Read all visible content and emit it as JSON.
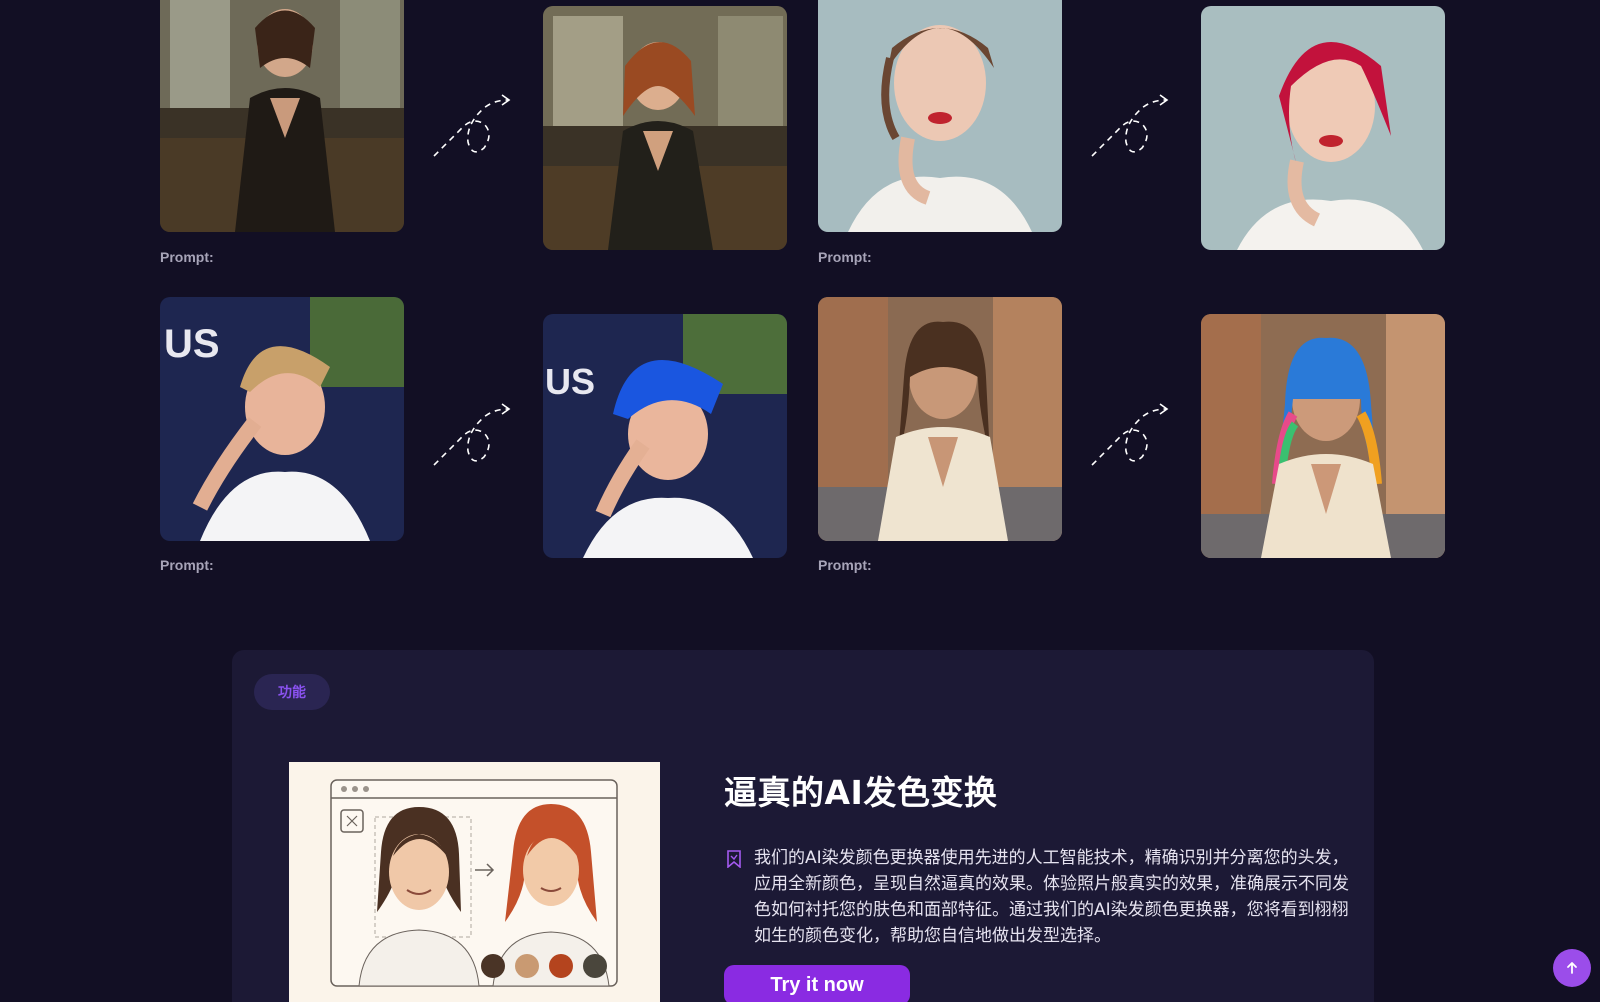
{
  "examples": [
    {
      "prompt_label": "Prompt:",
      "before_desc": "woman-dark-hair-black-dress",
      "after_desc": "woman-auburn-hair-black-dress"
    },
    {
      "prompt_label": "Prompt:",
      "before_desc": "woman-brown-hair-white-blouse",
      "after_desc": "woman-red-hair-white-blouse"
    },
    {
      "prompt_label": "Prompt:",
      "before_desc": "man-blonde-hair-white-tshirt",
      "after_desc": "man-blue-hair-white-tshirt"
    },
    {
      "prompt_label": "Prompt:",
      "before_desc": "woman-brown-hair-cream-blouse",
      "after_desc": "woman-rainbow-hair-cream-blouse"
    }
  ],
  "feature": {
    "badge": "功能",
    "title": "逼真的AI发色变换",
    "description": "我们的AI染发颜色更换器使用先进的人工智能技术，精确识别并分离您的头发，应用全新颜色，呈现自然逼真的效果。体验照片般真实的效果，准确展示不同发色如何衬托您的肤色和面部特征。通过我们的AI染发颜色更换器，您将看到栩栩如生的颜色变化，帮助您自信地做出发型选择。",
    "button_label": "Try it now"
  },
  "colors": {
    "background": "#120f24",
    "card": "#1c1935",
    "accent": "#8a2be2"
  },
  "icons": {
    "transform_arrow": "dashed-swirl-arrow-icon",
    "bookmark": "bookmark-icon",
    "back_to_top": "arrow-up-icon"
  }
}
